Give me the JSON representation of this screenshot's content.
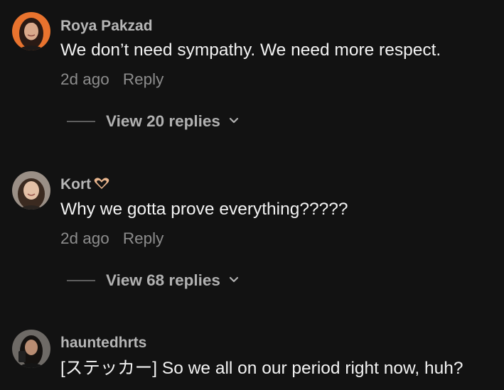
{
  "comments": [
    {
      "username": "Roya Pakzad",
      "text": "We don’t need sympathy. We need more respect.",
      "time": "2d ago",
      "reply_label": "Reply",
      "view_replies_label": "View 20 replies",
      "avatar_icon": "avatar-photo"
    },
    {
      "username": "Kort",
      "username_icon": "heart-hands-emoji",
      "text": "Why we gotta prove everything?????",
      "time": "2d ago",
      "reply_label": "Reply",
      "view_replies_label": "View 68 replies",
      "avatar_icon": "avatar-photo"
    },
    {
      "username": "hauntedhrts",
      "text": "[ステッカー] So we all on our period right now, huh?",
      "avatar_icon": "avatar-photo"
    }
  ],
  "colors": {
    "background": "#121212",
    "username": "#b6b6b6",
    "text": "#f2f2f2",
    "meta": "#8c8c8c",
    "view_replies": "#b1b1b1"
  }
}
